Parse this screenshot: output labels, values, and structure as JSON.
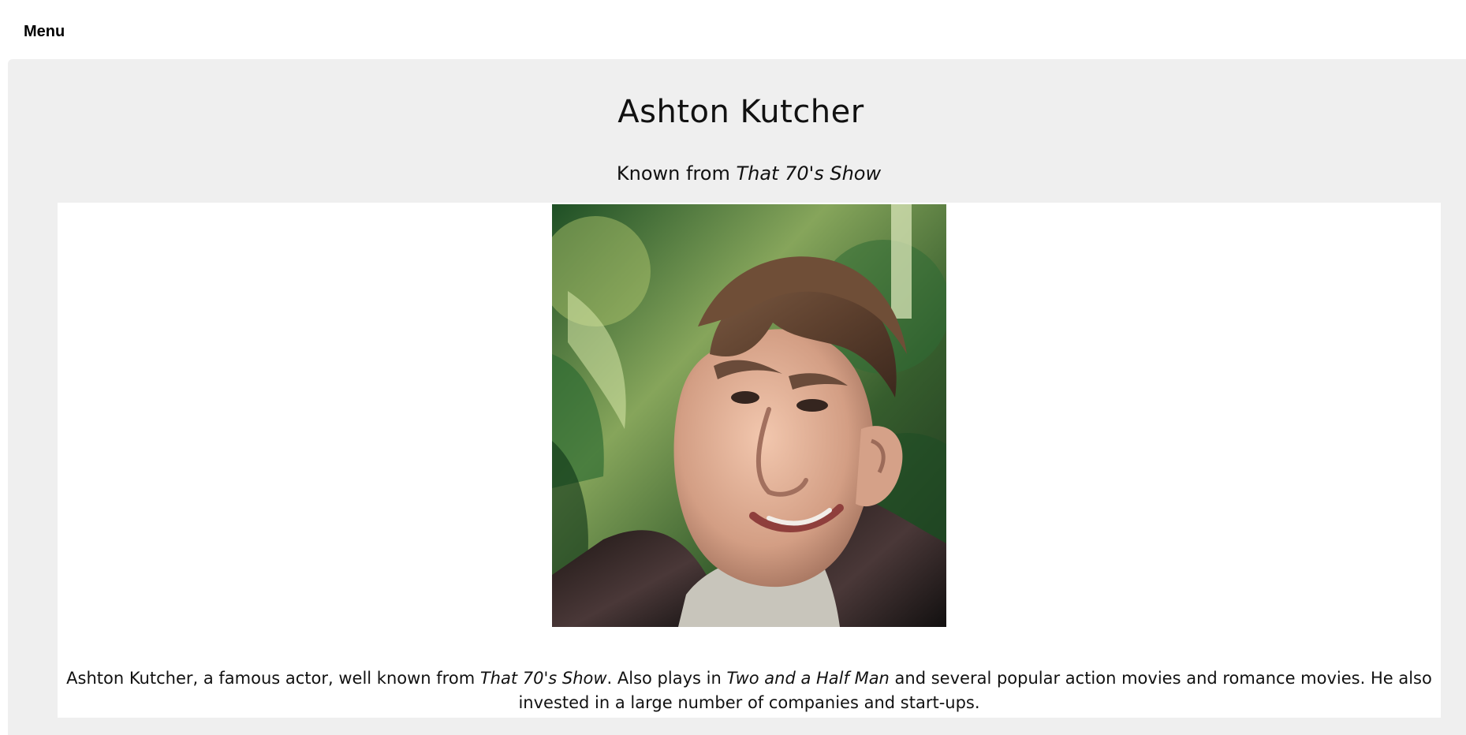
{
  "topbar": {
    "menu_label": "Menu"
  },
  "profile": {
    "name": "Ashton Kutcher",
    "known_from_prefix": "Known from ",
    "known_from_show": "That 70's Show",
    "portrait_alt": "Ashton Kutcher"
  },
  "description": {
    "part1": "Ashton Kutcher, a famous actor, well known from ",
    "show1": "That 70's Show",
    "part2": ". Also plays in ",
    "show2": "Two and a Half Man",
    "part3": " and several popular action movies and romance movies. He also invested in a large number of companies and start-ups."
  },
  "colors": {
    "panel_background": "#efefef",
    "card_background": "#ffffff",
    "text": "#111111"
  }
}
